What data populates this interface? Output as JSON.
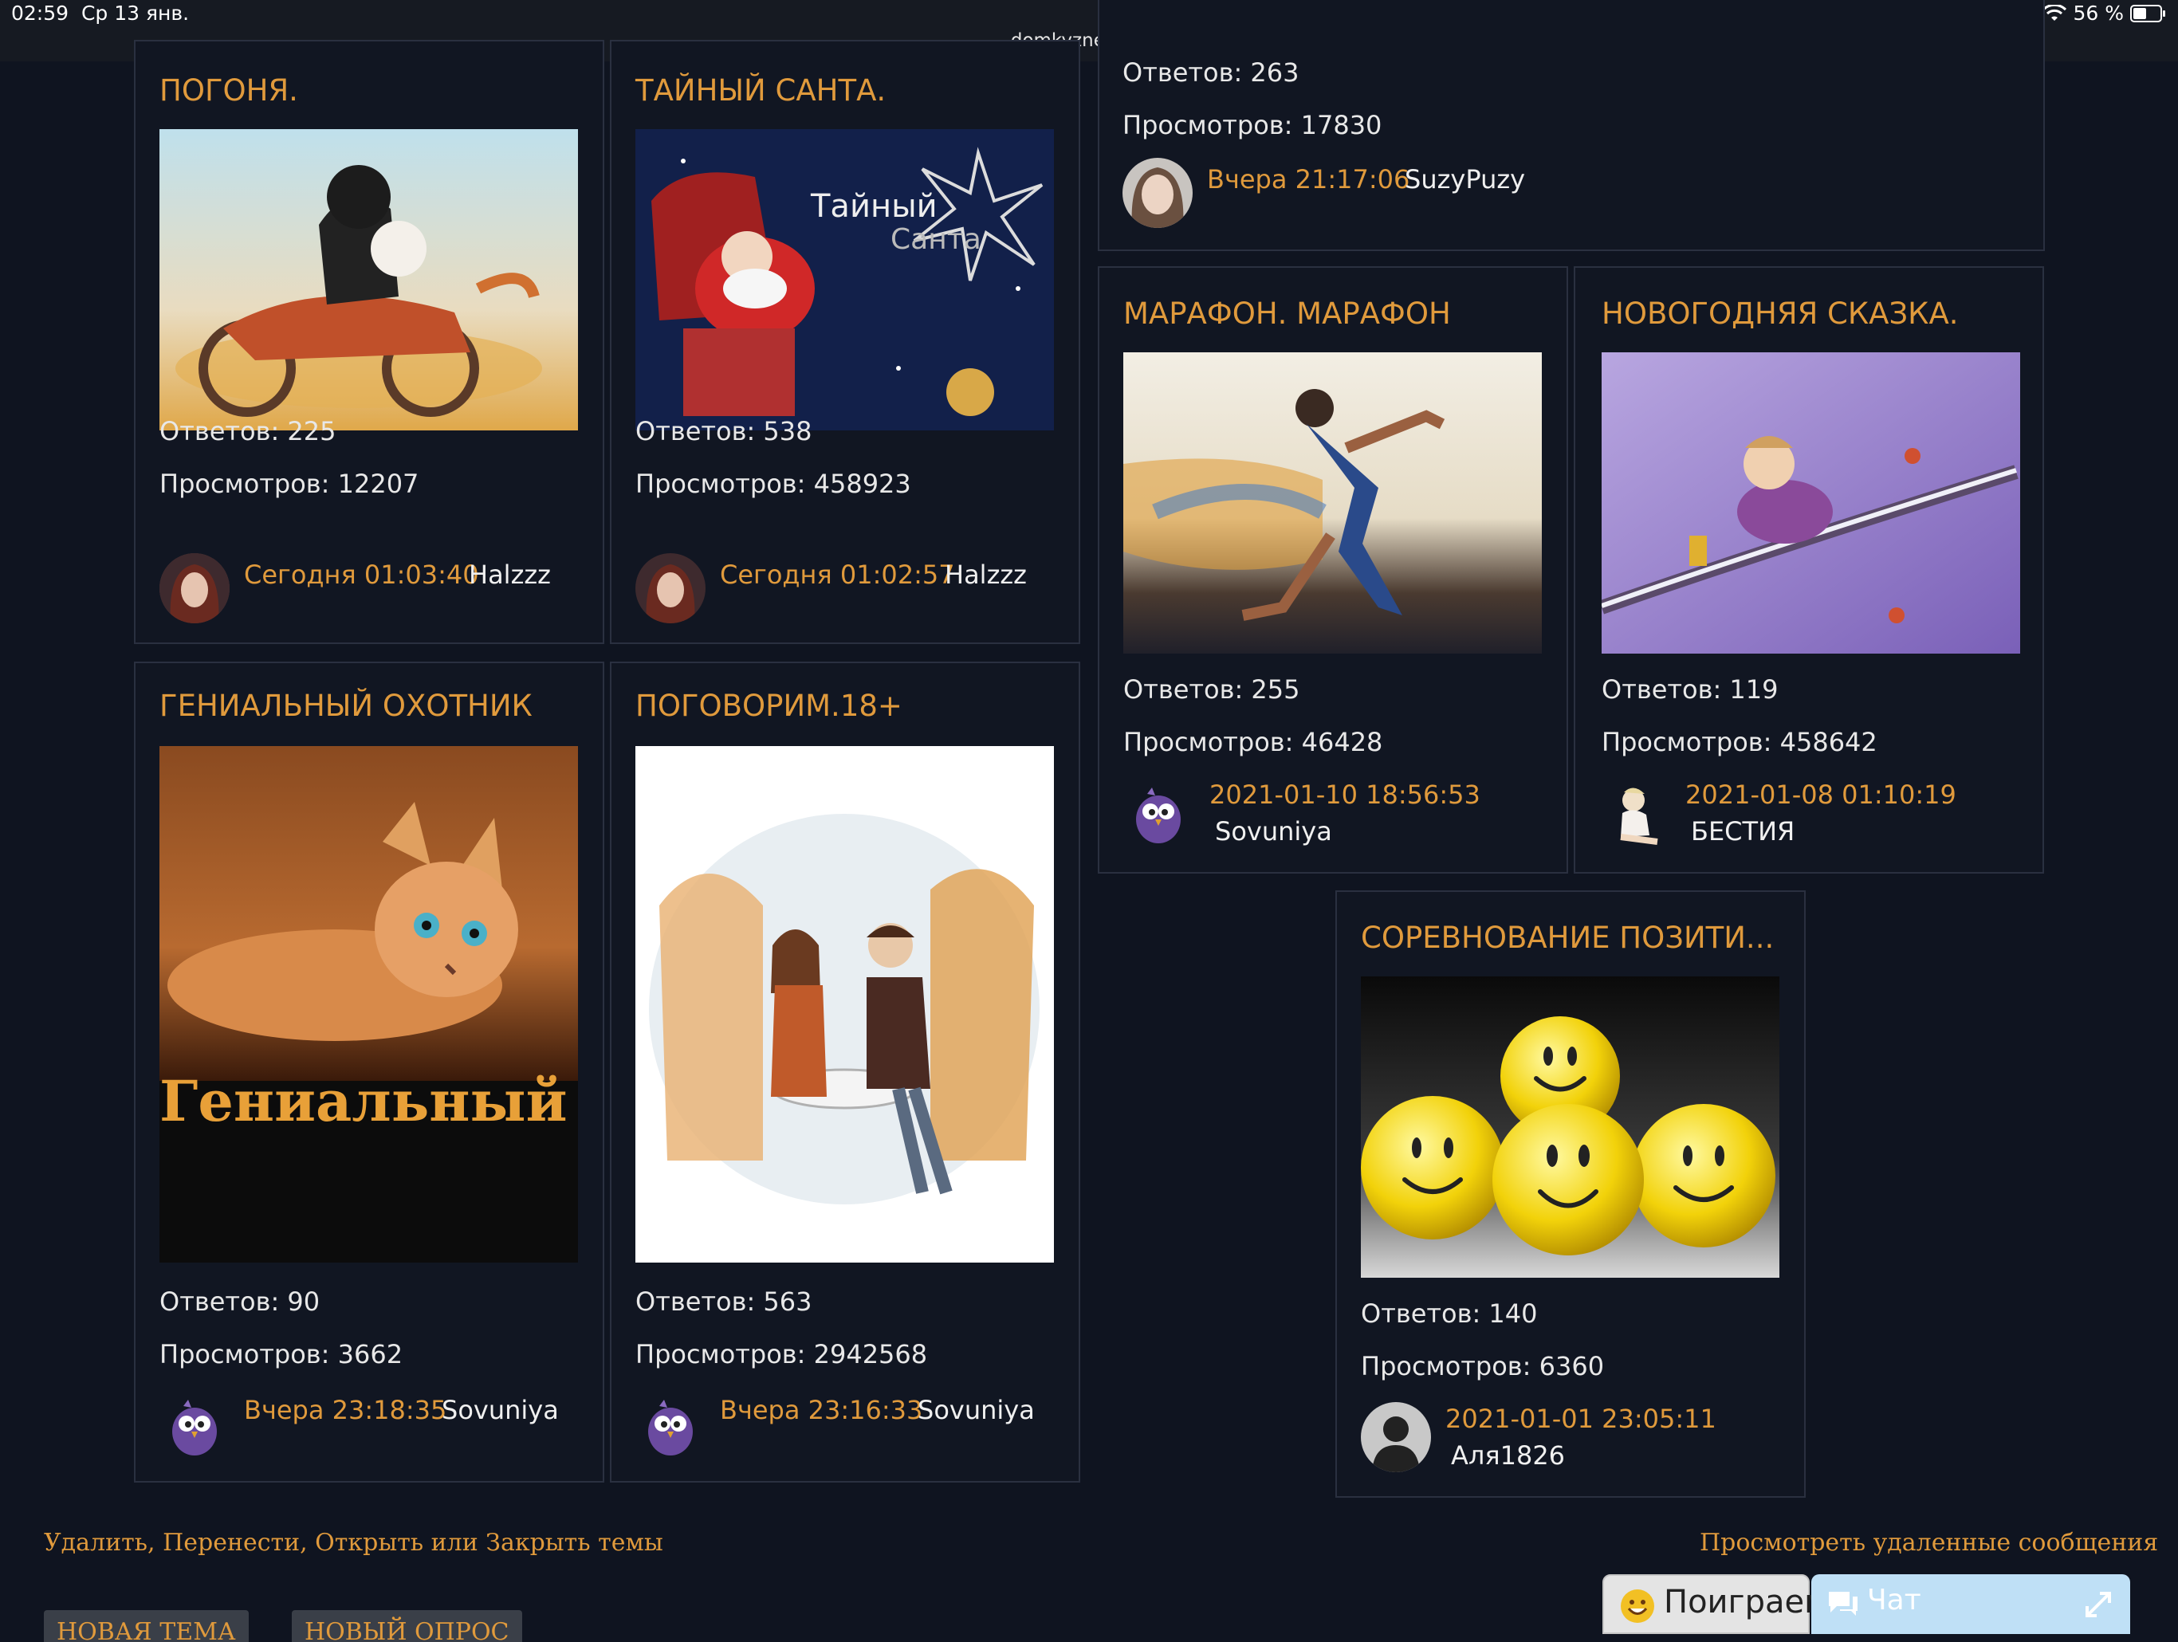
{
  "status_bar": {
    "time": "02:59",
    "date": "Ср 13 янв.",
    "url": "domkyznechik.ru",
    "battery": "56 %"
  },
  "labels": {
    "replies": "Ответов:",
    "views": "Просмотров:"
  },
  "cards": [
    {
      "id": "pogonya",
      "title": "ПОГОНЯ.",
      "replies": "225",
      "views": "12207",
      "last_date": "Сегодня 01:03:40",
      "last_user": "Halzzz",
      "avatar": "girl-avatar-icon"
    },
    {
      "id": "santa",
      "title": "ТАЙНЫЙ САНТА.",
      "replies": "538",
      "views": "458923",
      "last_date": "Сегодня 01:02:57",
      "last_user": "Halzzz",
      "avatar": "girl-avatar-icon",
      "image_text_1": "Тайный",
      "image_text_2": "Санта"
    },
    {
      "id": "top",
      "title": "",
      "replies": "263",
      "views": "17830",
      "last_date": "Вчера 21:17:06",
      "last_user": "SuzyPuzy",
      "avatar": "woman-avatar-icon"
    },
    {
      "id": "marathon",
      "title": "МАРАФОН. МАРАФОН",
      "replies": "255",
      "views": "46428",
      "last_date": "2021-01-10 18:56:53",
      "last_user": "Sovuniya",
      "avatar": "owl-avatar-icon"
    },
    {
      "id": "skazka",
      "title": "НОВОГОДНЯЯ СКАЗКА.",
      "replies": "119",
      "views": "458642",
      "last_date": "2021-01-08 01:10:19",
      "last_user": "БЕСТИЯ",
      "avatar": "pinup-avatar-icon"
    },
    {
      "id": "hunter",
      "title": "ГЕНИАЛЬНЫЙ ОХОТНИК",
      "replies": "90",
      "views": "3662",
      "last_date": "Вчера 23:18:35",
      "last_user": "Sovuniya",
      "avatar": "owl-avatar-icon",
      "image_text": "Гениальный"
    },
    {
      "id": "talk",
      "title": "ПОГОВОРИМ.18+",
      "replies": "563",
      "views": "2942568",
      "last_date": "Вчера 23:16:33",
      "last_user": "Sovuniya",
      "avatar": "owl-avatar-icon"
    },
    {
      "id": "positive",
      "title": "СОРЕВНОВАНИЕ ПОЗИТИ...",
      "replies": "140",
      "views": "6360",
      "last_date": "2021-01-01 23:05:11",
      "last_user": "Аля1826",
      "avatar": "default-user-icon"
    }
  ],
  "footer": {
    "moderate_link": "Удалить, Перенести, Открыть или Закрыть темы",
    "deleted_link": "Просмотреть удаленные сообщения",
    "new_topic": "НОВАЯ ТЕМА",
    "new_poll": "НОВЫЙ ОПРОС",
    "play": "Поиграем",
    "chat": "Чат"
  },
  "colors": {
    "accent": "#e09a3c",
    "background": "#0f1420",
    "card_border": "#2a3040"
  }
}
